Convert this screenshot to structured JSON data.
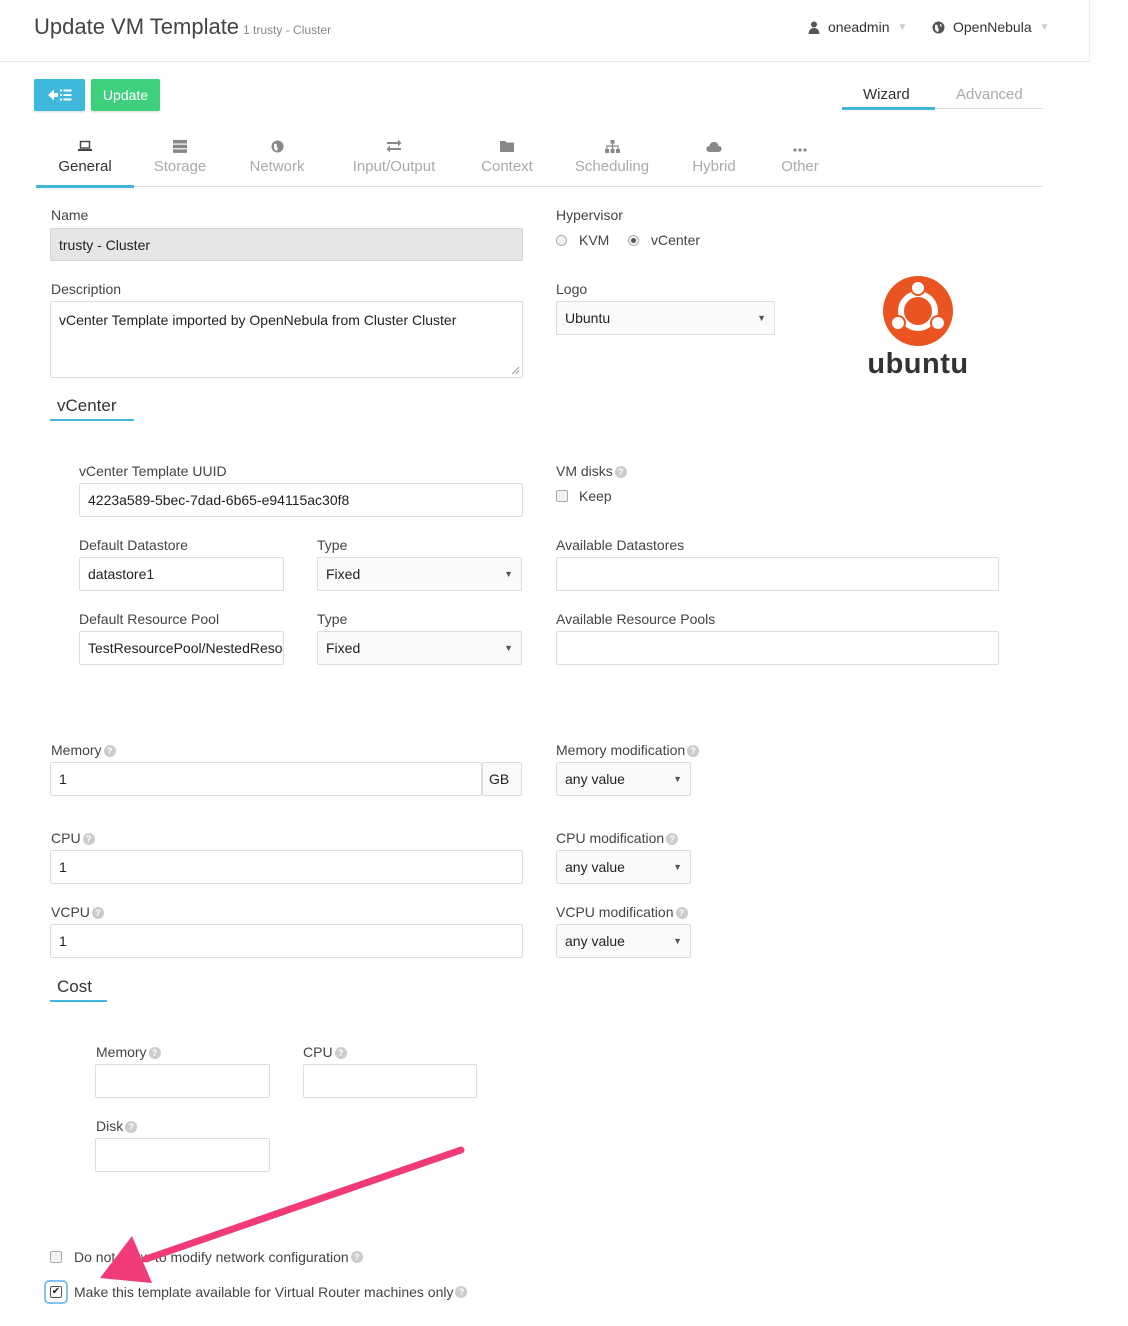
{
  "header": {
    "title": "Update VM Template",
    "subtitle": "1 trusty - Cluster",
    "user": "oneadmin",
    "zone": "OpenNebula"
  },
  "toolbar": {
    "update_label": "Update"
  },
  "mode_tabs": {
    "wizard": "Wizard",
    "advanced": "Advanced"
  },
  "tabs": {
    "general": "General",
    "storage": "Storage",
    "network": "Network",
    "io": "Input/Output",
    "context": "Context",
    "scheduling": "Scheduling",
    "hybrid": "Hybrid",
    "other": "Other"
  },
  "general": {
    "name_label": "Name",
    "name_value": "trusty - Cluster",
    "description_label": "Description",
    "description_value": "vCenter Template imported by OpenNebula from Cluster Cluster",
    "hypervisor_label": "Hypervisor",
    "hv_kvm": "KVM",
    "hv_vcenter": "vCenter",
    "hv_selected": "vCenter",
    "logo_label": "Logo",
    "logo_value": "Ubuntu",
    "logo_text": "ubuntu"
  },
  "vcenter": {
    "section_title": "vCenter",
    "uuid_label": "vCenter Template UUID",
    "uuid_value": "4223a589-5bec-7dad-6b65-e94115ac30f8",
    "vm_disks_label": "VM disks",
    "keep_label": "Keep",
    "default_ds_label": "Default Datastore",
    "default_ds_value": "datastore1",
    "type_label": "Type",
    "ds_type_value": "Fixed",
    "available_ds_label": "Available Datastores",
    "default_rp_label": "Default Resource Pool",
    "default_rp_value": "TestResourcePool/NestedResourcePool",
    "rp_type_value": "Fixed",
    "available_rp_label": "Available Resource Pools"
  },
  "capacity": {
    "memory_label": "Memory",
    "memory_value": "1",
    "memory_unit": "GB",
    "memory_mod_label": "Memory modification",
    "memory_mod_value": "any value",
    "cpu_label": "CPU",
    "cpu_value": "1",
    "cpu_mod_label": "CPU modification",
    "cpu_mod_value": "any value",
    "vcpu_label": "VCPU",
    "vcpu_value": "1",
    "vcpu_mod_label": "VCPU modification",
    "vcpu_mod_value": "any value"
  },
  "cost": {
    "section_title": "Cost",
    "memory_label": "Memory",
    "cpu_label": "CPU",
    "disk_label": "Disk"
  },
  "options": {
    "no_network_label": "Do not allow to modify network configuration",
    "no_network_checked": false,
    "vrouter_label": "Make this template available for Virtual Router machines only",
    "vrouter_checked": true
  },
  "colors": {
    "accent": "#3fb8dc",
    "update_button": "#3fd07d",
    "ubuntu_logo": "#e95420",
    "annotation_arrow": "#f03a7a"
  }
}
